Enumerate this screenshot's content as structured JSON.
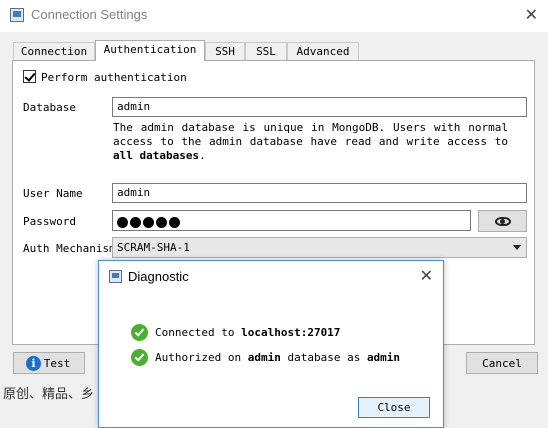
{
  "window": {
    "title": "Connection Settings",
    "close_glyph": "✕"
  },
  "tabs": [
    {
      "label": "Connection"
    },
    {
      "label": "Authentication",
      "active": true
    },
    {
      "label": "SSH"
    },
    {
      "label": "SSL"
    },
    {
      "label": "Advanced"
    }
  ],
  "auth": {
    "perform_label": "Perform authentication",
    "perform_checked": true,
    "database_label": "Database",
    "database_value": "admin",
    "description_parts": [
      "The admin database is unique in MongoDB. Users with normal access to the admin database have read and write access to ",
      "all databases",
      "."
    ],
    "username_label": "User Name",
    "username_value": "admin",
    "password_label": "Password",
    "password_dots": 5,
    "mechanism_label": "Auth Mechanism",
    "mechanism_value": "SCRAM-SHA-1"
  },
  "footer": {
    "test_label": "Test",
    "cancel_label": "Cancel"
  },
  "background_text": "原创、精品、乡",
  "dialog": {
    "title": "Diagnostic",
    "close_glyph": "✕",
    "line1": {
      "prefix": "Connected to ",
      "host": "localhost:27017"
    },
    "line2": {
      "p1": "Authorized on ",
      "db": "admin",
      "p2": " database as ",
      "user": "admin"
    },
    "close_label": "Close"
  },
  "colors": {
    "accent": "#4a8fd8",
    "success": "#4bb032",
    "info": "#1f6fc5"
  }
}
